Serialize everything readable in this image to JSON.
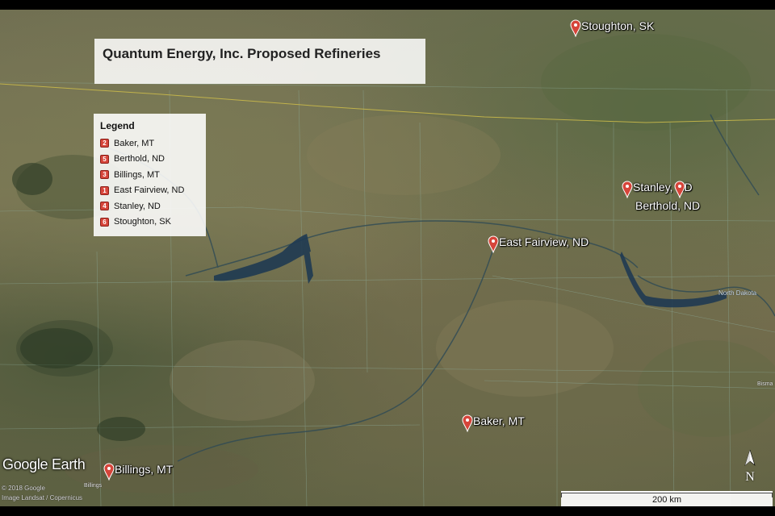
{
  "map": {
    "title": "Quantum Energy, Inc. Proposed Refineries",
    "legend": {
      "title": "Legend",
      "items": [
        {
          "num": "2",
          "label": "Baker, MT"
        },
        {
          "num": "5",
          "label": "Berthold, ND"
        },
        {
          "num": "3",
          "label": "Billings, MT"
        },
        {
          "num": "1",
          "label": "East Fairview, ND"
        },
        {
          "num": "4",
          "label": "Stanley, ND"
        },
        {
          "num": "6",
          "label": "Stoughton, SK"
        }
      ]
    },
    "markers": {
      "stoughton": "Stoughton, SK",
      "stanley": "Stanley, ND",
      "berthold": "Berthold, ND",
      "east_fairview": "East Fairview, ND",
      "baker": "Baker, MT",
      "billings": "Billings, MT"
    },
    "small_labels": {
      "north_dakota": "North Dakota",
      "bismarck_partial": "Bisma",
      "billings_small": "Billings"
    },
    "brand": "Google Earth",
    "copyright_lines": [
      "© 2018 Google",
      "Image Landsat / Copernicus"
    ],
    "scale_label": "200 km",
    "north_label": "N",
    "colors": {
      "marker": "#d6453a",
      "border_line": "#c9b94a",
      "water": "#1f3a52"
    }
  }
}
